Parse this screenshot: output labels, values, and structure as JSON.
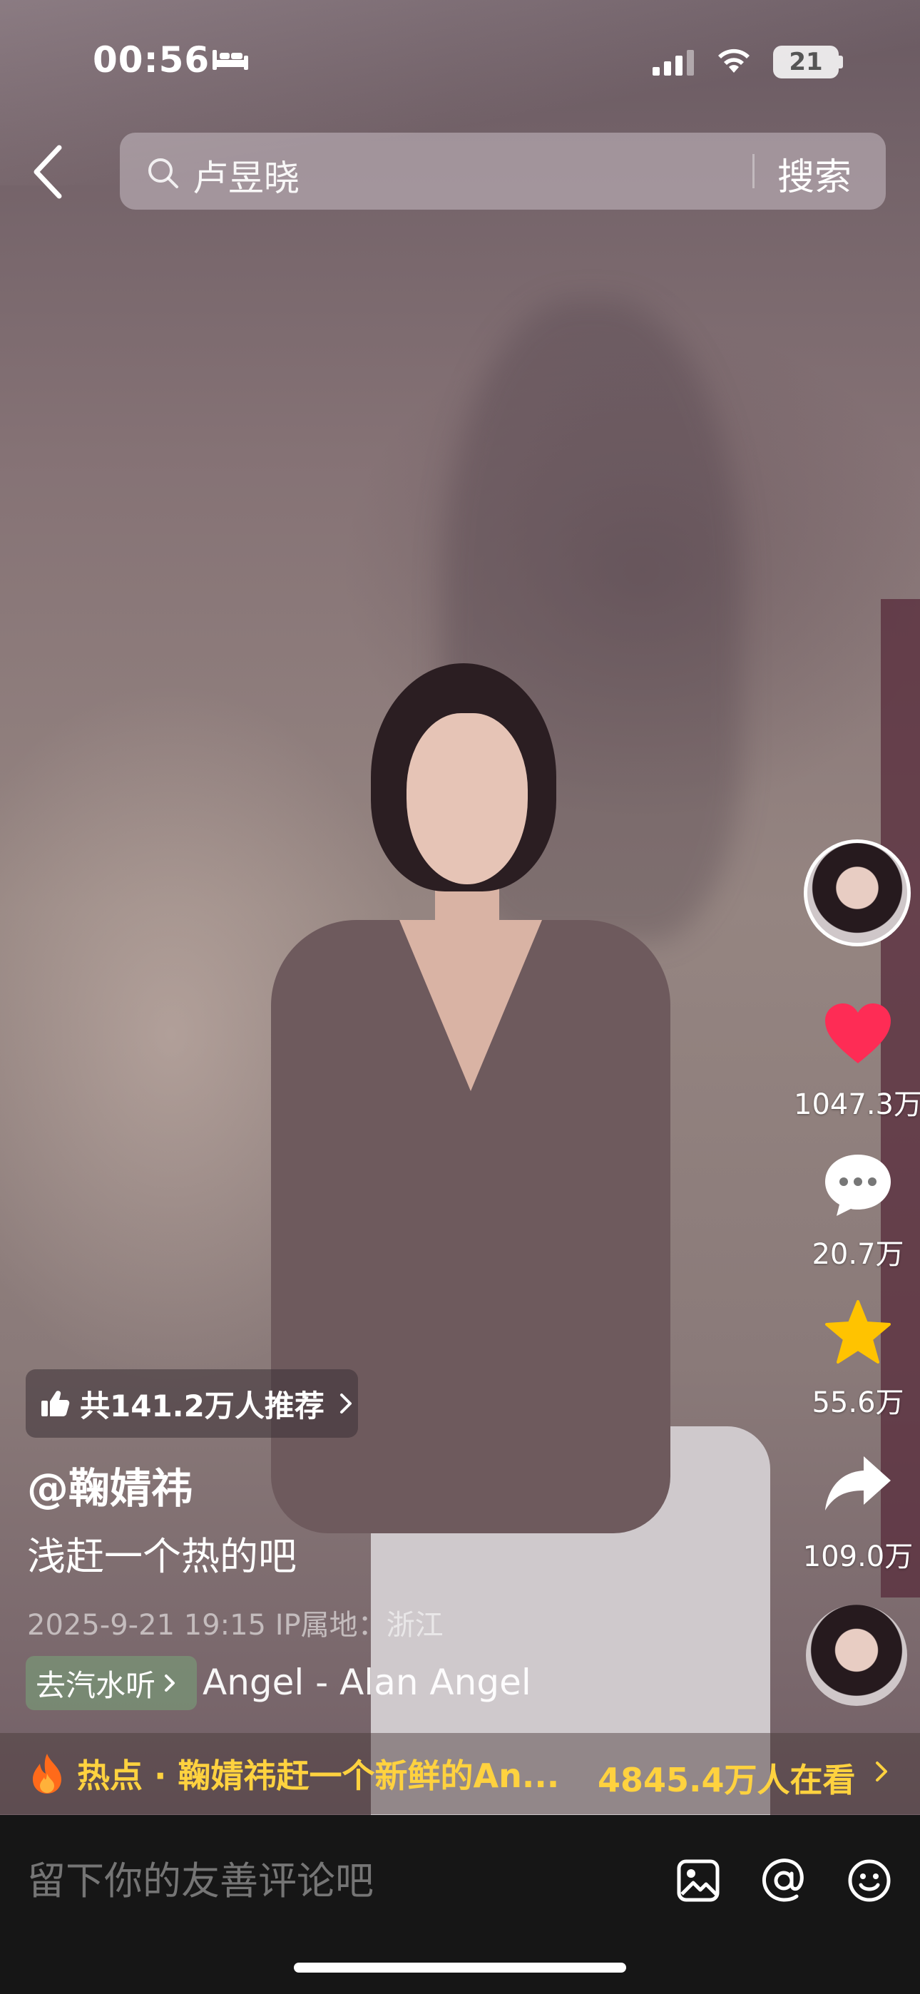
{
  "status": {
    "time": "00:56",
    "battery": "21"
  },
  "search": {
    "query": "卢昱晓",
    "button": "搜索"
  },
  "actions": {
    "likes": "1047.3万",
    "comments": "20.7万",
    "favorites": "55.6万",
    "shares": "109.0万"
  },
  "colors": {
    "like": "#fe2c55",
    "favorite": "#ffc300",
    "hot": "#ffd23f"
  },
  "video": {
    "recommend": "共141.2万人推荐",
    "author": "@鞠婧祎",
    "caption": "浅赶一个热的吧",
    "meta": "2025-9-21 19:15   IP属地：浙江",
    "music_tag": "去汽水听",
    "music_marquee": "Angel - Alan   Angel"
  },
  "hotspot": {
    "label": "热点 · 鞠婧祎赶一个新鲜的An...",
    "watching": "4845.4万人在看"
  },
  "comment": {
    "placeholder": "留下你的友善评论吧"
  },
  "icons": [
    "bed-icon",
    "signal-icon",
    "wifi-icon",
    "back-icon",
    "search-icon",
    "heart-icon",
    "comment-icon",
    "star-icon",
    "share-icon",
    "fire-icon",
    "thumb-up-icon",
    "image-icon",
    "at-icon",
    "emoji-icon"
  ]
}
